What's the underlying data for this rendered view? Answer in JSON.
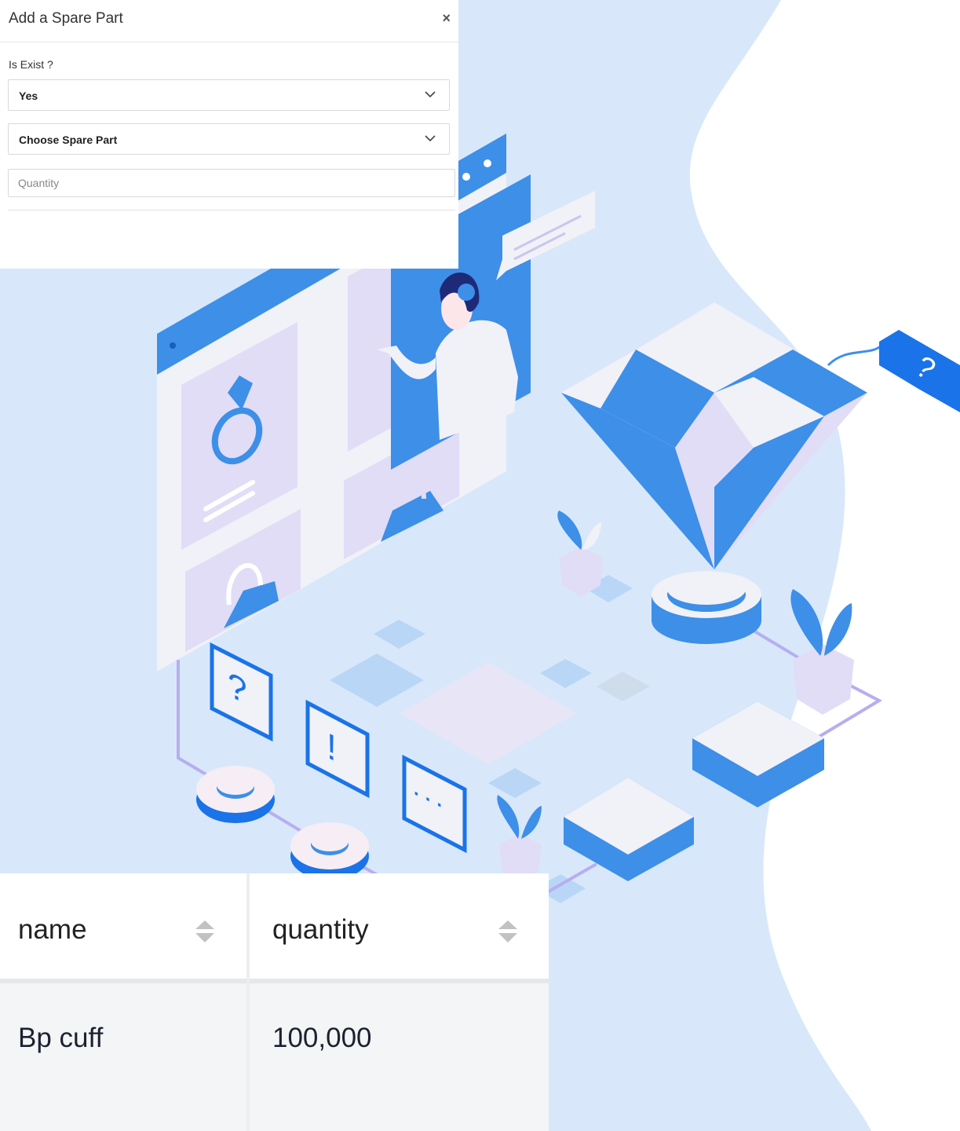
{
  "modal": {
    "title": "Add a Spare Part",
    "close_label": "×",
    "is_exist_label": "Is Exist ?",
    "is_exist_value": "Yes",
    "spare_part_value": "Choose Spare Part",
    "quantity_placeholder": "Quantity"
  },
  "table": {
    "columns": [
      "name",
      "quantity"
    ],
    "rows": [
      {
        "name": "Bp cuff",
        "quantity": "100,000"
      }
    ]
  },
  "illustration": {
    "question_mark": "?",
    "exclamation_mark": "!",
    "ellipsis": "· · ·",
    "tag_mark": "?"
  },
  "colors": {
    "accent_blue": "#3d8fe8",
    "light_blue_bg": "#d8e8fa",
    "lavender": "#e1ddf7",
    "white": "#ffffff"
  }
}
